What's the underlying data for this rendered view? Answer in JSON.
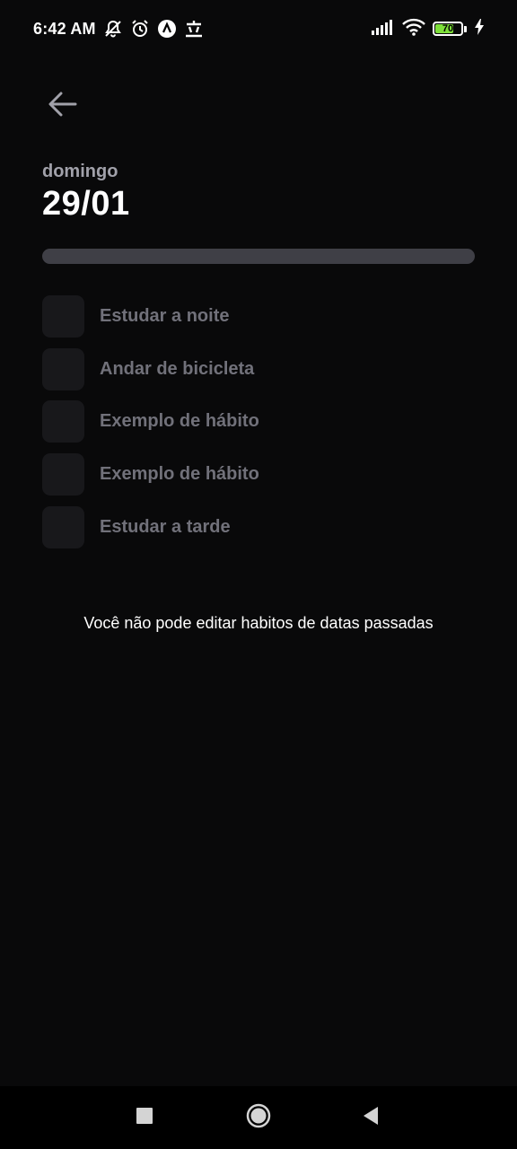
{
  "status_bar": {
    "time": "6:42 AM",
    "battery_level": "70",
    "icons": [
      "muted-bell-icon",
      "alarm-icon",
      "app-a-icon",
      "app-chinese-icon",
      "signal-icon",
      "wifi-icon",
      "battery-icon",
      "charging-icon"
    ]
  },
  "header": {
    "back_icon": "arrow-left-icon",
    "weekday": "domingo",
    "date": "29/01"
  },
  "progress": {
    "percent": 0,
    "track_color": "#3f3f46"
  },
  "habits": [
    {
      "label": "Estudar a noite",
      "checked": false
    },
    {
      "label": "Andar de bicicleta",
      "checked": false
    },
    {
      "label": "Exemplo de hábito",
      "checked": false
    },
    {
      "label": "Exemplo de hábito",
      "checked": false
    },
    {
      "label": "Estudar a tarde",
      "checked": false
    }
  ],
  "notice": "Você não pode editar habitos de datas passadas",
  "nav_bar": {
    "icons": [
      "recent-apps-icon",
      "home-icon",
      "back-icon"
    ]
  },
  "colors": {
    "background": "#09090a",
    "checkbox": "#18181b",
    "habit_text": "#71717a",
    "weekday_text": "#a1a1aa",
    "battery_fill": "#7ee03a"
  }
}
